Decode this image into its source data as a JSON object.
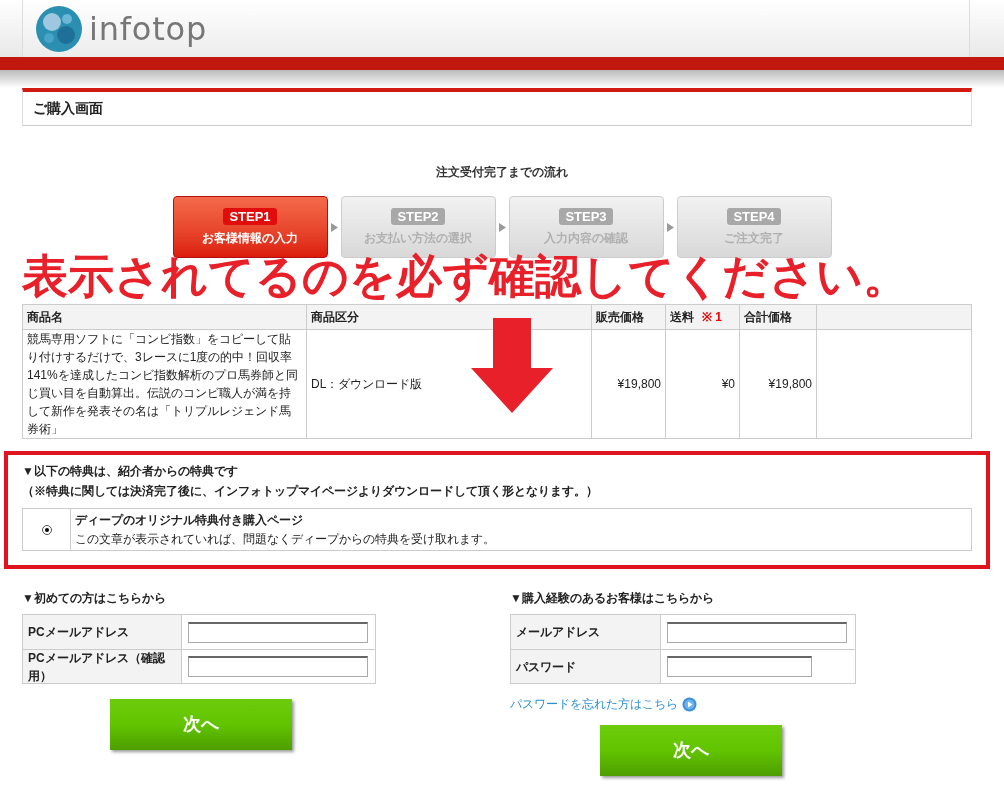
{
  "logo": {
    "text": "infotop"
  },
  "page_title": "ご購入画面",
  "flow": {
    "title": "注文受付完了までの流れ",
    "steps": [
      {
        "badge": "STEP1",
        "label": "お客様情報の入力",
        "selected": true
      },
      {
        "badge": "STEP2",
        "label": "お支払い方法の選択",
        "selected": false
      },
      {
        "badge": "STEP3",
        "label": "入力内容の確認",
        "selected": false
      },
      {
        "badge": "STEP4",
        "label": "ご注文完了",
        "selected": false
      }
    ]
  },
  "annotation": {
    "text": "表示されてるのを必ず確認してください。"
  },
  "order_table": {
    "columns": [
      {
        "label": "商品名"
      },
      {
        "label": "商品区分"
      },
      {
        "label": "販売価格"
      },
      {
        "label": "送料",
        "note": "※ 1"
      },
      {
        "label": "合計価格"
      }
    ],
    "rows": [
      {
        "cells": [
          "競馬専用ソフトに「コンビ指数」をコピーして貼り付けするだけで、3レースに1度の的中！回収率141%を達成したコンビ指数解析のプロ馬券師と同じ買い目を自動算出。伝説のコンビ職人が満を持して新作を発表その名は「トリプルレジェンド馬券術」",
          "DL：ダウンロード版",
          "¥19,800",
          "¥0",
          "¥19,800"
        ]
      }
    ]
  },
  "bonus": {
    "heading": "▼以下の特典は、紹介者からの特典です",
    "note": "（※特典に関しては決済完了後に、インフォトップマイページよりダウンロードして頂く形となります。）",
    "options": [
      {
        "title": "ディープのオリジナル特典付き購入ページ",
        "description": "この文章が表示されていれば、問題なくディープからの特典を受け取れます。",
        "selected": true
      }
    ]
  },
  "new_customer": {
    "heading": "▼初めての方はこちらから",
    "fields": [
      {
        "label": "PCメールアドレス"
      },
      {
        "label": "PCメールアドレス（確認用）"
      }
    ],
    "button": "次へ"
  },
  "returning_customer": {
    "heading": "▼購入経験のあるお客様はこちらから",
    "fields": [
      {
        "label": "メールアドレス"
      },
      {
        "label": "パスワード"
      }
    ],
    "link": "パスワードを忘れた方はこちら",
    "button": "次へ"
  }
}
